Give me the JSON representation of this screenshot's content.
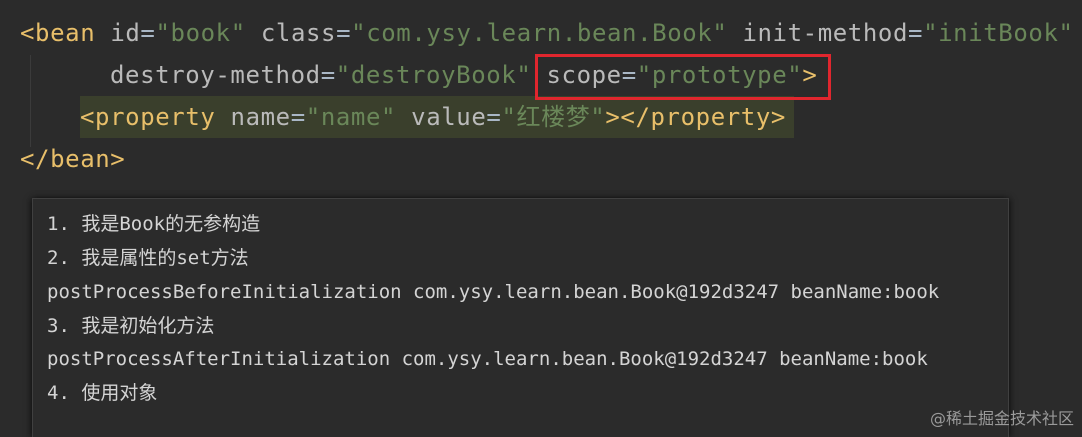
{
  "code": {
    "line1": {
      "open": "<bean",
      "a1": "id",
      "v1": "\"book\"",
      "a2": "class",
      "v2": "\"com.ysy.learn.bean.Book\"",
      "a3": "init-method",
      "v3": "\"initBook\""
    },
    "line2": {
      "a1": "destroy-method",
      "v1": "\"destroyBook\"",
      "a2": "scope",
      "v2": "\"prototype\"",
      "close": ">"
    },
    "line3": {
      "open": "<property",
      "a1": "name",
      "v1": "\"name\"",
      "a2": "value",
      "v2": "\"红楼梦\"",
      "close": "></property>"
    },
    "line4": {
      "close": "</bean>"
    },
    "eq": "="
  },
  "console": {
    "lines": [
      "1. 我是Book的无参构造",
      "2. 我是属性的set方法",
      "postProcessBeforeInitialization com.ysy.learn.bean.Book@192d3247 beanName:book",
      "3. 我是初始化方法",
      "postProcessAfterInitialization com.ysy.learn.bean.Book@192d3247 beanName:book",
      "4. 使用对象"
    ]
  },
  "watermark": "@稀土掘金技术社区",
  "colors": {
    "tag": "#e8bf6a",
    "string": "#6a8759",
    "attribute": "#bababa",
    "highlight_box": "#e0262e",
    "background": "#2b2b2b"
  }
}
